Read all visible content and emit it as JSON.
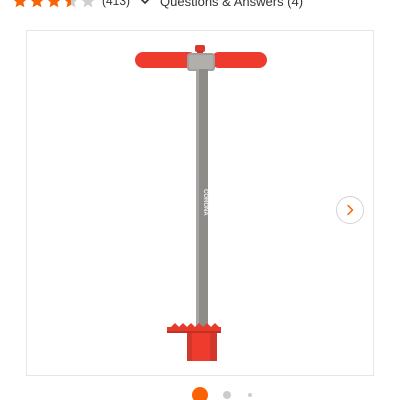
{
  "rating": {
    "stars": 3.5,
    "max_stars": 5,
    "review_count": "(413)",
    "qa_link": "Questions & Answers (4)"
  },
  "product_image": {
    "brand_text": "CORONA"
  },
  "carousel": {
    "next_icon": "chevron-right-icon",
    "pages": 3,
    "active_page": 1
  },
  "colors": {
    "accent": "#f96302",
    "star_empty": "#cfcfcf",
    "handle_red": "#ef3b2d",
    "shaft_gray": "#8d8c89",
    "dot_inactive": "#cccccc"
  }
}
